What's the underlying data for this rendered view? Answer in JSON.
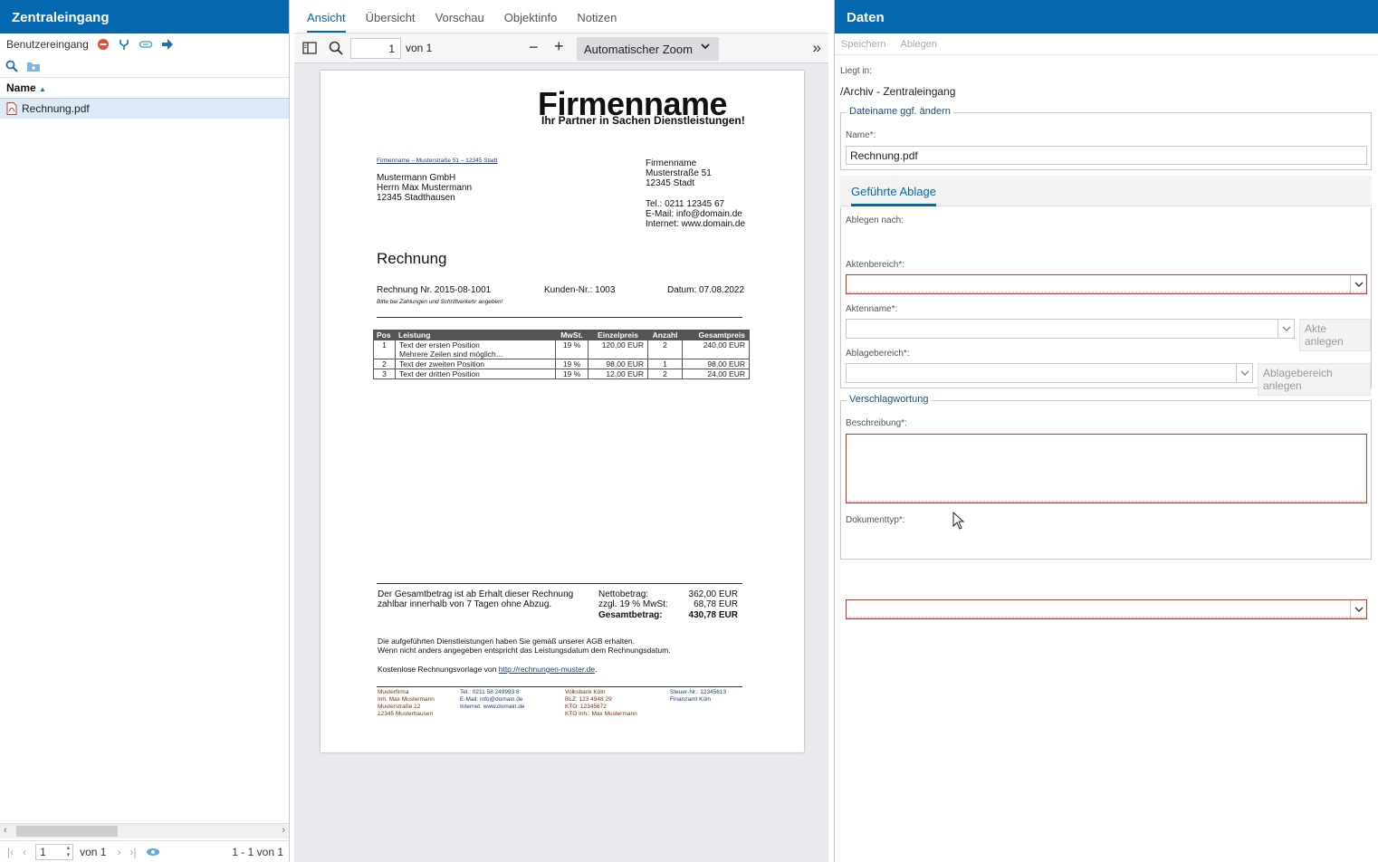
{
  "left_panel": {
    "title": "Zentraleingang",
    "inbox_label": "Benutzereingang",
    "column_name": "Name",
    "files": [
      {
        "name": "Rechnung.pdf"
      }
    ],
    "pager": {
      "page": "1",
      "of": "von 1",
      "range": "1 - 1 von 1"
    }
  },
  "viewer": {
    "tabs": [
      "Ansicht",
      "Übersicht",
      "Vorschau",
      "Objektinfo",
      "Notizen"
    ],
    "page_input": "1",
    "page_of": "von 1",
    "zoom": "Automatischer Zoom",
    "doc": {
      "company": "Firmenname",
      "slogan": "Ihr Partner in Sachen Dienstleistungen!",
      "sender_line": "Firmenname – Musterstraße 51 – 12345 Stadt",
      "recipient": [
        "Mustermann GmbH",
        "Herrn Max Mustermann",
        "12345 Stadthausen"
      ],
      "company_address": [
        "Firmenname",
        "Musterstraße 51",
        "12345 Stadt"
      ],
      "contact": [
        "Tel.: 0211 12345 67",
        "E-Mail: info@domain.de",
        "Internet: www.domain.de"
      ],
      "heading": "Rechnung",
      "invoice_no": "Rechnung Nr. 2015-08-1001",
      "customer_no": "Kunden-Nr.: 1003",
      "date": "Datum: 07.08.2022",
      "note": "Bitte bei Zahlungen und Schriftverkehr angeben!",
      "table_headers": [
        "Pos",
        "Leistung",
        "MwSt.",
        "Einzelpreis",
        "Anzahl",
        "Gesamtpreis"
      ],
      "table_rows": [
        [
          "1",
          "Text der ersten Position",
          "19 %",
          "120,00 EUR",
          "2",
          "240,00 EUR"
        ],
        [
          "",
          "Mehrere Zeilen sind möglich…",
          "",
          "",
          "",
          ""
        ],
        [
          "2",
          "Text der zweiten Position",
          "19 %",
          "98,00 EUR",
          "1",
          "98,00 EUR"
        ],
        [
          "3",
          "Text der dritten Position",
          "19 %",
          "12,00 EUR",
          "2",
          "24,00 EUR"
        ]
      ],
      "payment_text": [
        "Der Gesamtbetrag ist ab Erhalt dieser Rechnung",
        "zahlbar innerhalb von 7 Tagen ohne Abzug."
      ],
      "totals": [
        {
          "label": "Nettobetrag:",
          "value": "362,00 EUR"
        },
        {
          "label": "zzgl. 19 % MwSt:",
          "value": "68,78 EUR"
        },
        {
          "label": "Gesamtbetrag:",
          "value": "430,78 EUR"
        }
      ],
      "terms": [
        "Die aufgeführten Dienstleistungen haben Sie gemäß unserer AGB erhalten.",
        "Wenn nicht anders angegeben entspricht das Leistungsdatum dem Rechnungsdatum."
      ],
      "template_text": "Kostenlose Rechnungsvorlage von ",
      "template_link": "http://rechnungen-muster.de",
      "template_end": ".",
      "footer_cols": [
        [
          "Musterfirma",
          "Inh. Max Mustermann",
          "Musterstraße 12",
          "12345 Musterhausen"
        ],
        [
          "Tel.: 0211 58 249993 8",
          "E-Mail: info@domain.de",
          "Internet: www.domain.de"
        ],
        [
          "Volksbank Köln",
          "BLZ: 123 4948 29",
          "KTO: 12345672",
          "KTO Inh.: Max Mustermann"
        ],
        [
          "Steuer-Nr.: 12345613",
          "Finanzamt Köln"
        ]
      ]
    }
  },
  "right_panel": {
    "title": "Daten",
    "toolbar": {
      "save": "Speichern",
      "file": "Ablegen"
    },
    "location_label": "Liegt in:",
    "location_value": "/Archiv - Zentraleingang",
    "rename_legend": "Dateiname ggf. ändern",
    "name_label": "Name*:",
    "name_value": "Rechnung.pdf",
    "guided_tab": "Geführte Ablage",
    "file_to_label": "Ablegen nach:",
    "aktenbereich_label": "Aktenbereich*:",
    "aktenname_label": "Aktenname*:",
    "akte_btn": "Akte anlegen",
    "ablagebereich_label": "Ablagebereich*:",
    "ablagebereich_btn": "Ablagebereich anlegen",
    "keywords_legend": "Verschlagwortung",
    "beschreibung_label": "Beschreibung*:",
    "dokumenttyp_label": "Dokumenttyp*:"
  },
  "colors": {
    "accent": "#0667b1",
    "error": "#c0392b",
    "selected_row": "#dce9f6"
  }
}
